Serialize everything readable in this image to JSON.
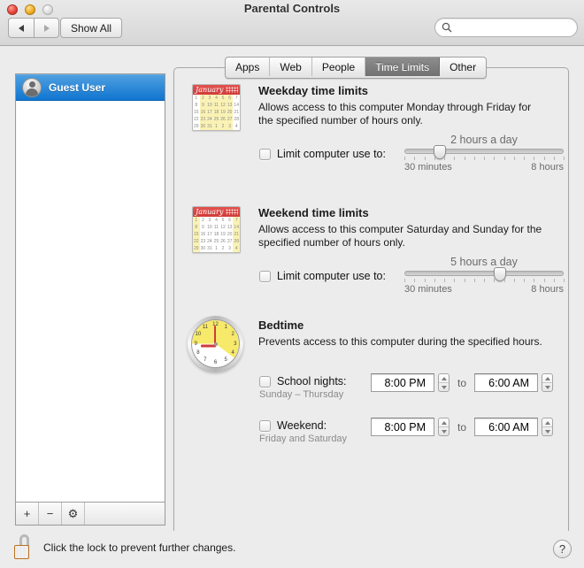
{
  "window": {
    "title": "Parental Controls",
    "traffic_lights": [
      "close",
      "minimize",
      "zoom"
    ]
  },
  "toolbar": {
    "back_label": "◀",
    "forward_label": "▶",
    "show_all_label": "Show All",
    "search": {
      "value": "",
      "placeholder": ""
    }
  },
  "sidebar": {
    "users": [
      {
        "name": "Guest User",
        "selected": true
      }
    ],
    "buttons": [
      {
        "name": "add",
        "label": "+"
      },
      {
        "name": "remove",
        "label": "−"
      },
      {
        "name": "action",
        "label": "⚙"
      }
    ]
  },
  "tabs": [
    {
      "label": "Apps",
      "active": false
    },
    {
      "label": "Web",
      "active": false
    },
    {
      "label": "People",
      "active": false
    },
    {
      "label": "Time Limits",
      "active": true
    },
    {
      "label": "Other",
      "active": false
    }
  ],
  "weekday": {
    "title": "Weekday time limits",
    "description": "Allows access to this computer Monday through Friday for the specified number of hours only.",
    "checkbox_label": "Limit computer use to:",
    "checked": false,
    "slider": {
      "value_label": "2 hours a day",
      "min_label": "30 minutes",
      "max_label": "8 hours",
      "percent": 22
    },
    "calendar": {
      "month": "January",
      "weeks": [
        [
          "1",
          "2",
          "3",
          "4",
          "5",
          "6",
          "7"
        ],
        [
          "8",
          "9",
          "10",
          "11",
          "12",
          "13",
          "14"
        ],
        [
          "15",
          "16",
          "17",
          "18",
          "19",
          "20",
          "21"
        ],
        [
          "22",
          "23",
          "24",
          "25",
          "26",
          "27",
          "28"
        ],
        [
          "29",
          "30",
          "31",
          "1",
          "2",
          "3",
          "4"
        ]
      ],
      "highlight": "weekdays"
    }
  },
  "weekend": {
    "title": "Weekend time limits",
    "description": "Allows access to this computer Saturday and Sunday for the specified number of hours only.",
    "checkbox_label": "Limit computer use to:",
    "checked": false,
    "slider": {
      "value_label": "5 hours a day",
      "min_label": "30 minutes",
      "max_label": "8 hours",
      "percent": 60
    },
    "calendar": {
      "month": "January",
      "weeks": [
        [
          "1",
          "2",
          "3",
          "4",
          "5",
          "6",
          "7"
        ],
        [
          "8",
          "9",
          "10",
          "11",
          "12",
          "13",
          "14"
        ],
        [
          "15",
          "16",
          "17",
          "18",
          "19",
          "20",
          "21"
        ],
        [
          "22",
          "23",
          "24",
          "25",
          "26",
          "27",
          "28"
        ],
        [
          "29",
          "30",
          "31",
          "1",
          "2",
          "3",
          "4"
        ]
      ],
      "highlight": "weekends"
    }
  },
  "bedtime": {
    "title": "Bedtime",
    "description": "Prevents access to this computer during the specified hours.",
    "rows": [
      {
        "checkbox_label": "School nights:",
        "checked": false,
        "sub_label": "Sunday – Thursday",
        "from_time": "8:00 PM",
        "to_label": "to",
        "to_time": "6:00 AM"
      },
      {
        "checkbox_label": "Weekend:",
        "checked": false,
        "sub_label": "Friday and Saturday",
        "from_time": "8:00 PM",
        "to_label": "to",
        "to_time": "6:00 AM"
      }
    ]
  },
  "footer": {
    "lock_text": "Click the lock to prevent further changes.",
    "lock_state": "unlocked",
    "help_label": "?"
  },
  "colors": {
    "accent_selection": "#1076d0",
    "calendar_header": "#d03b38",
    "calendar_highlight": "#faf2b4",
    "clock_highlight": "#f7e96a",
    "lock_body": "#e09a3e",
    "window_bg": "#ececec"
  }
}
